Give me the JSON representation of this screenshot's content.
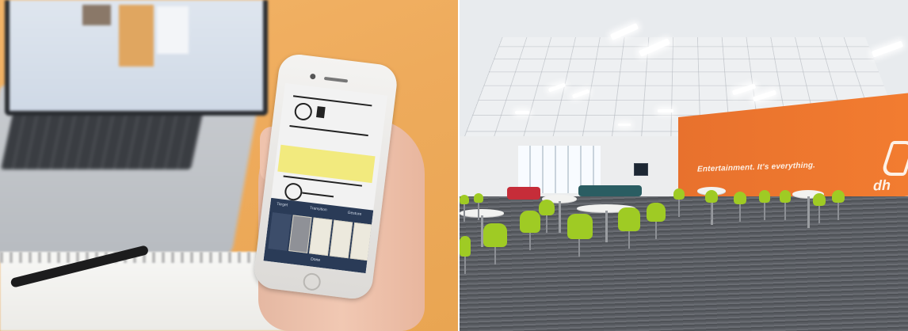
{
  "images": {
    "left": {
      "description_icons": [
        "laptop-icon",
        "phone-icon",
        "pen-icon"
      ],
      "phone_app": {
        "tabs": [
          "Target",
          "Transition",
          "Gesture"
        ],
        "done_label": "Done"
      }
    },
    "right": {
      "wall_slogan": "Entertainment. It's everything.",
      "wall_logo_text": "dh"
    }
  },
  "colors": {
    "desk_orange": "#eeab5c",
    "wall_orange": "#f27c30",
    "chair_green": "#9fcb24",
    "carpet_grey": "#5a5d63"
  }
}
